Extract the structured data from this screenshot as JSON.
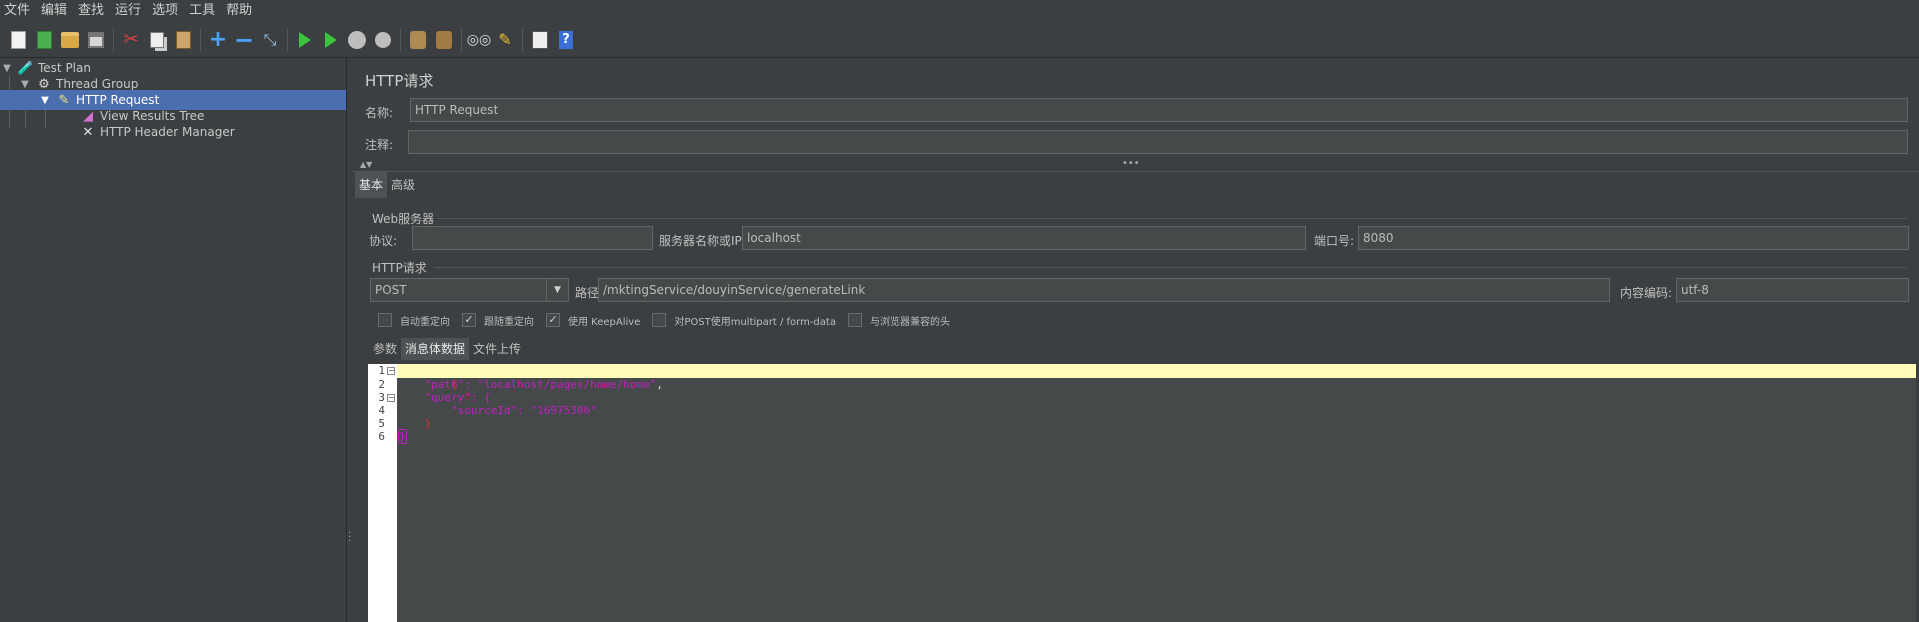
{
  "menu": [
    "文件",
    "编辑",
    "查找",
    "运行",
    "选项",
    "工具",
    "帮助"
  ],
  "toolbar": {
    "icons": [
      "new-icon",
      "template-icon",
      "open-icon",
      "save-icon",
      "cut-icon",
      "copy-icon",
      "paste-icon",
      "expand-icon",
      "collapse-icon",
      "toggle-icon",
      "start-icon",
      "start-no-pause-icon",
      "stop-icon",
      "shutdown-icon",
      "clear-icon",
      "clear-all-icon",
      "search-icon",
      "reset-search-icon",
      "function-helper-icon",
      "help-icon"
    ]
  },
  "tree": {
    "nodes": [
      {
        "label": "Test Plan",
        "icon": "test-plan-icon"
      },
      {
        "label": "Thread Group",
        "icon": "gear-icon"
      },
      {
        "label": "HTTP Request",
        "icon": "pipette-icon"
      },
      {
        "label": "View Results Tree",
        "icon": "chart-icon"
      },
      {
        "label": "HTTP Header Manager",
        "icon": "tools-icon"
      }
    ]
  },
  "panel": {
    "title": "HTTP请求",
    "name_label": "名称:",
    "name_value": "HTTP Request",
    "comment_label": "注释:",
    "comment_value": ""
  },
  "tabs": {
    "basic": "基本",
    "advanced": "高级"
  },
  "web_server": {
    "section": "Web服务器",
    "protocol_label": "协议:",
    "protocol_value": "",
    "server_label": "服务器名称或IP:",
    "server_value": "localhost",
    "port_label": "端口号:",
    "port_value": "8080"
  },
  "http_request": {
    "section": "HTTP请求",
    "method": "POST",
    "path_label": "路径:",
    "path_value": "/mktingService/douyinService/generateLink",
    "encoding_label": "内容编码:",
    "encoding_value": "utf-8"
  },
  "options": [
    {
      "label": "自动重定向",
      "checked": false
    },
    {
      "label": "跟随重定向",
      "checked": true
    },
    {
      "label": "使用 KeepAlive",
      "checked": true
    },
    {
      "label": "对POST使用multipart / form-data",
      "checked": false
    },
    {
      "label": "与浏览器兼容的头",
      "checked": false
    }
  ],
  "subtabs": {
    "params": "参数",
    "body": "消息体数据",
    "files": "文件上传"
  },
  "editor": {
    "line_numbers": [
      "1",
      "2",
      "3",
      "4",
      "5",
      "6"
    ],
    "line1": "{",
    "line2_key": "\"path\"",
    "line2_sep": ": ",
    "line2_val": "\"localhost/pages/home/home\"",
    "line2_end": ",",
    "line3_key": "\"query\"",
    "line3_sep": ": {",
    "line4_key": "\"sourceId\"",
    "line4_sep": ": ",
    "line4_val": "\"16975306\"",
    "line5": "}",
    "line6": "}"
  }
}
